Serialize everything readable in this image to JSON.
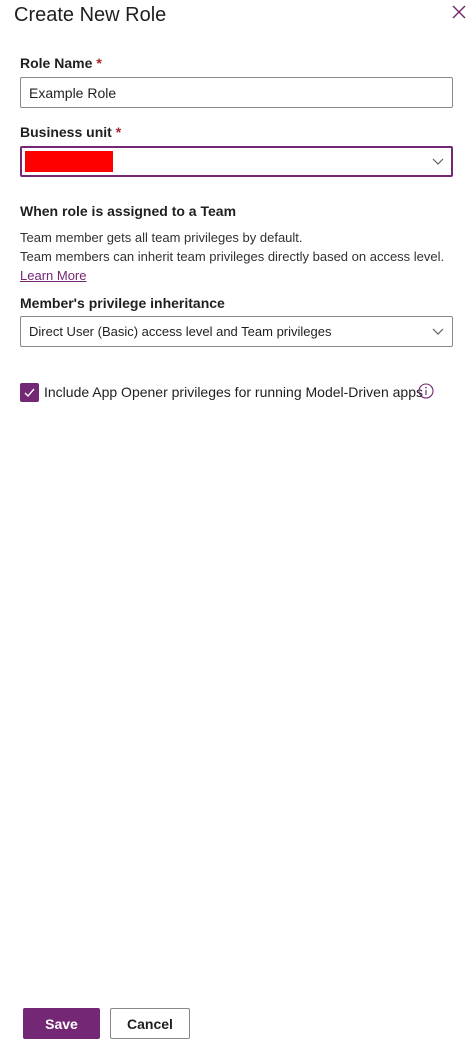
{
  "panel": {
    "title": "Create New Role"
  },
  "role_name": {
    "label": "Role Name",
    "required_marker": "*",
    "value": "Example Role"
  },
  "business_unit": {
    "label": "Business unit",
    "required_marker": "*",
    "value_redacted": true
  },
  "team_section": {
    "heading": "When role is assigned to a Team",
    "line1": "Team member gets all team privileges by default.",
    "line2": "Team members can inherit team privileges directly based on access level.",
    "learn_more": "Learn More"
  },
  "inheritance": {
    "label": "Member's privilege inheritance",
    "selected": "Direct User (Basic) access level and Team privileges"
  },
  "app_opener": {
    "label": "Include App Opener privileges for running Model-Driven apps",
    "checked": true
  },
  "footer": {
    "save_label": "Save",
    "cancel_label": "Cancel"
  },
  "colors": {
    "accent": "#742774",
    "required": "#a4262c",
    "redaction": "#ff0000",
    "border": "#8a8886"
  },
  "icons": {
    "close": "close-icon",
    "chevron": "chevron-down-icon",
    "check": "checkmark-icon",
    "info": "info-icon"
  }
}
